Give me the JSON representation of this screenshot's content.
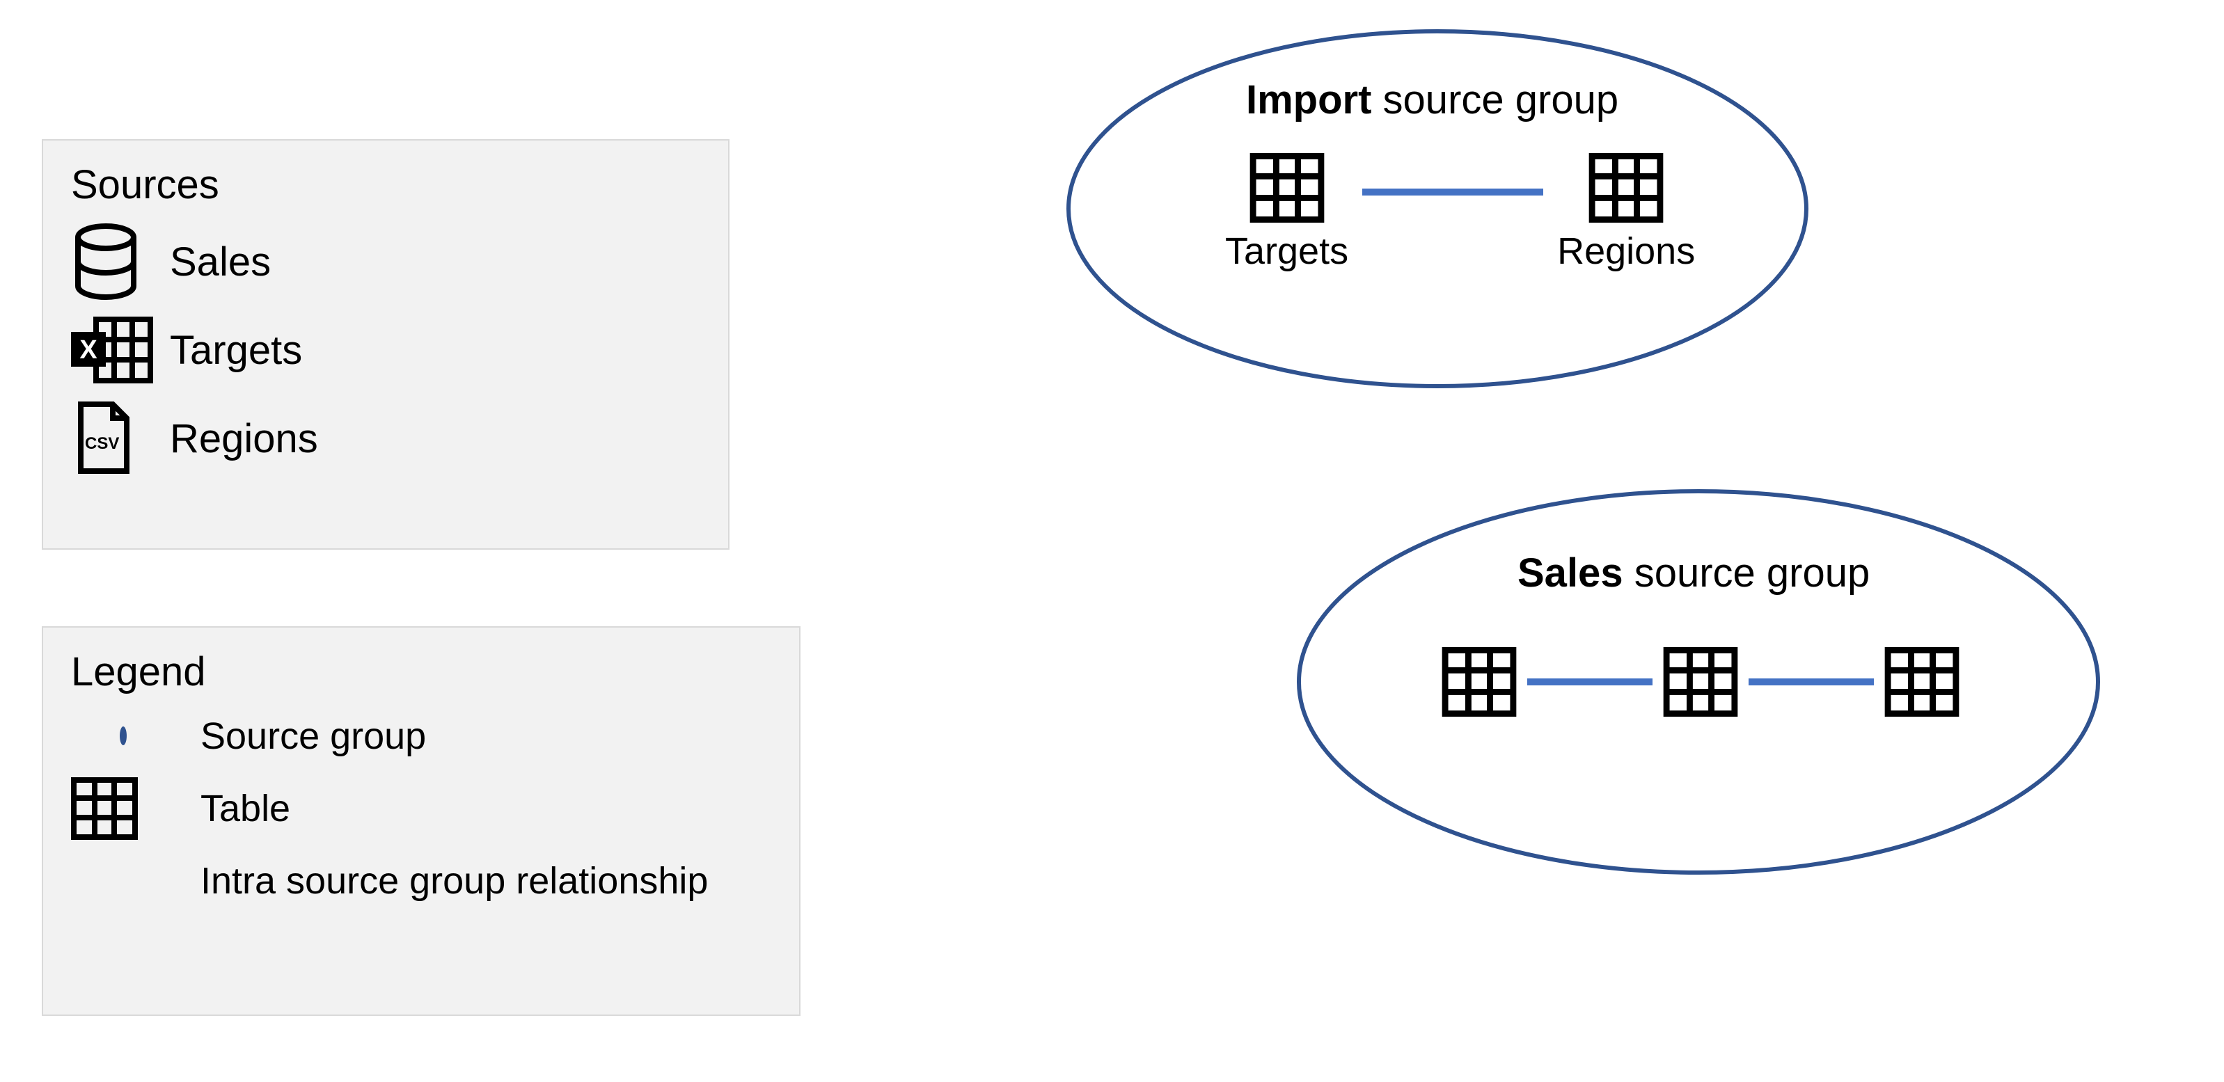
{
  "sources_panel": {
    "title": "Sources",
    "items": [
      {
        "icon": "database-icon",
        "label": "Sales"
      },
      {
        "icon": "excel-icon",
        "label": "Targets"
      },
      {
        "icon": "csv-file-icon",
        "label": "Regions"
      }
    ]
  },
  "legend_panel": {
    "title": "Legend",
    "items": [
      {
        "icon": "ellipse-icon",
        "label": "Source group"
      },
      {
        "icon": "table-icon",
        "label": "Table"
      },
      {
        "icon": "line-icon",
        "label": "Intra source group relationship"
      }
    ]
  },
  "source_groups": {
    "import": {
      "title_bold": "Import",
      "title_rest": " source group",
      "tables": [
        {
          "label": "Targets"
        },
        {
          "label": "Regions"
        }
      ]
    },
    "sales": {
      "title_bold": "Sales",
      "title_rest": " source group",
      "table_count": 3
    }
  },
  "colors": {
    "ellipse_stroke": "#2f528f",
    "relationship_line": "#4472c4",
    "panel_bg": "#f2f2f2"
  }
}
